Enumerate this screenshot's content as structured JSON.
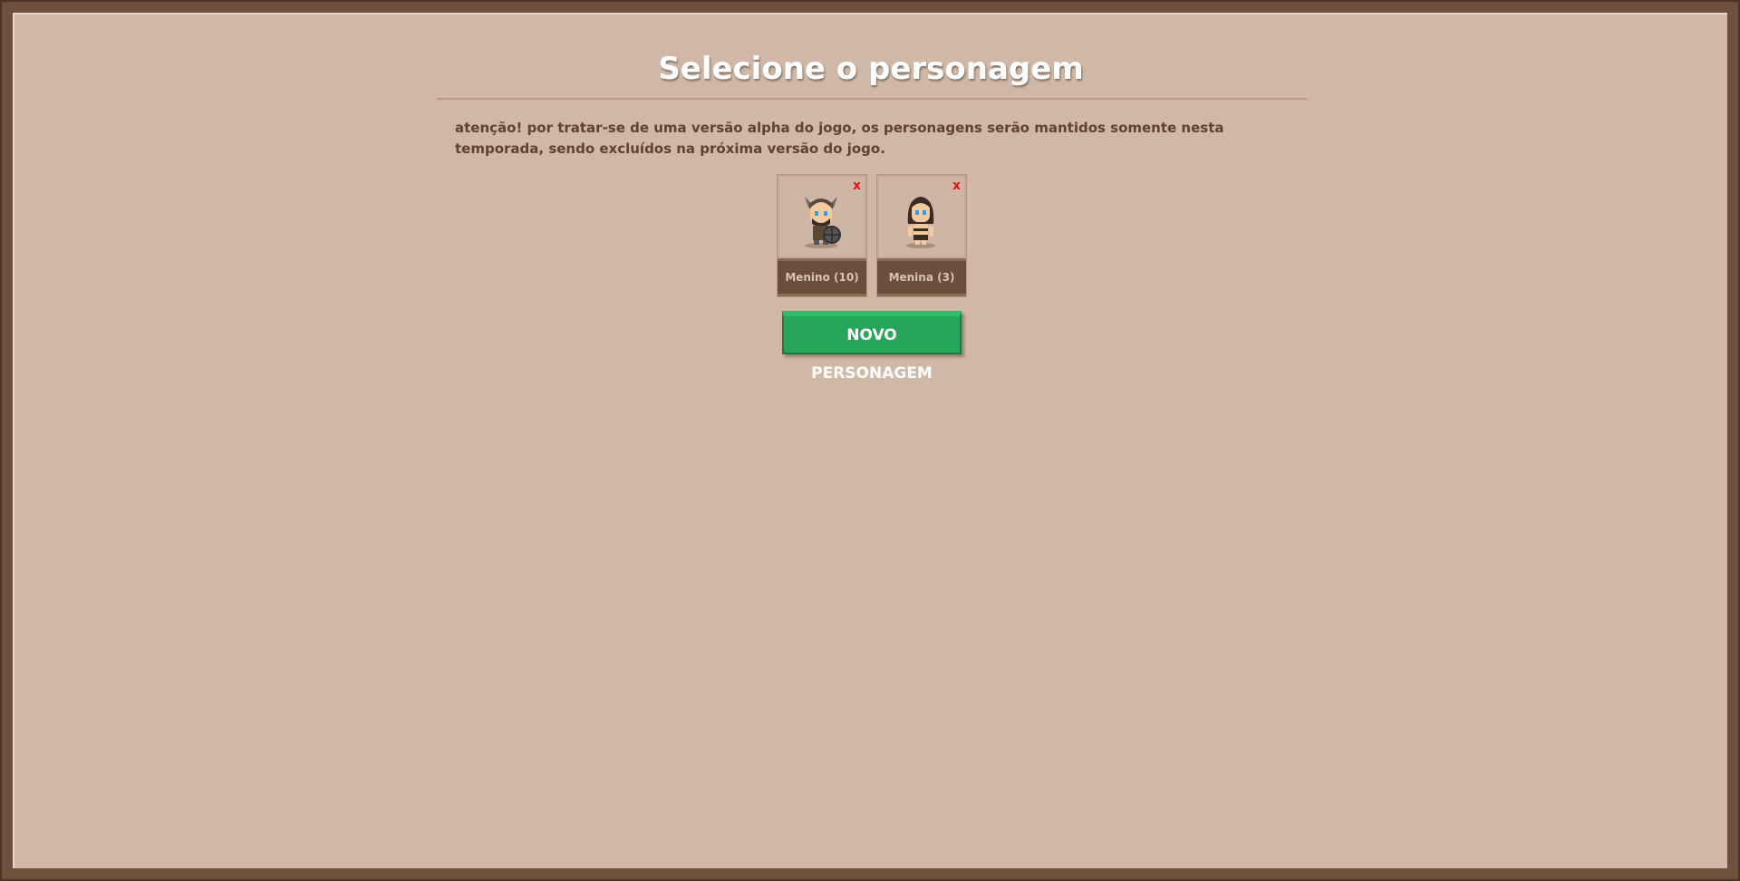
{
  "title": "Selecione o personagem",
  "notice": "atenção! por tratar-se de uma versão alpha do jogo, os personagens serão mantidos somente nesta temporada, sendo excluídos na próxima versão do jogo.",
  "characters": [
    {
      "name": "Menino (10)",
      "delete": "x",
      "avatar": "viking-boy"
    },
    {
      "name": "Menina (3)",
      "delete": "x",
      "avatar": "cave-girl"
    }
  ],
  "new_character_label": "NOVO PERSONAGEM",
  "colors": {
    "background": "#d1b8a6",
    "frame": "#6e513d",
    "button": "#26a65b",
    "delete": "#e0141c"
  }
}
